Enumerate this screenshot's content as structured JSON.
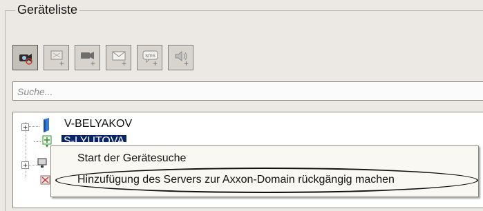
{
  "group": {
    "title": "Geräteliste"
  },
  "toolbar": {
    "buttons": [
      {
        "name": "search-cameras-button",
        "icon": "camera-search-icon",
        "active": true
      },
      {
        "name": "add-device-button",
        "icon": "add-device-icon"
      },
      {
        "name": "add-camera-button",
        "icon": "add-camera-icon"
      },
      {
        "name": "add-email-button",
        "icon": "add-email-icon"
      },
      {
        "name": "add-sms-button",
        "icon": "add-sms-icon",
        "text": "sms"
      },
      {
        "name": "add-speaker-button",
        "icon": "add-speaker-icon"
      }
    ],
    "plus": "+"
  },
  "search": {
    "placeholder": "Suche..."
  },
  "tree": {
    "nodes": [
      {
        "label": "V-BELYAKOV",
        "icon": "server-icon",
        "expander": "+"
      },
      {
        "label": "S-LYUTOVA",
        "icon": "add-server-icon",
        "selected": true
      },
      {
        "icon": "computer-icon",
        "expander": "+"
      },
      {
        "icon": "disconnected-server-icon"
      }
    ]
  },
  "context_menu": {
    "items": [
      {
        "label": "Start der Gerätesuche"
      },
      {
        "label": "Hinzufügung des Servers zur Axxon-Domain rückgängig machen",
        "circled": true
      }
    ]
  },
  "colors": {
    "selection": "#0a246a",
    "background": "#ece9e4"
  }
}
